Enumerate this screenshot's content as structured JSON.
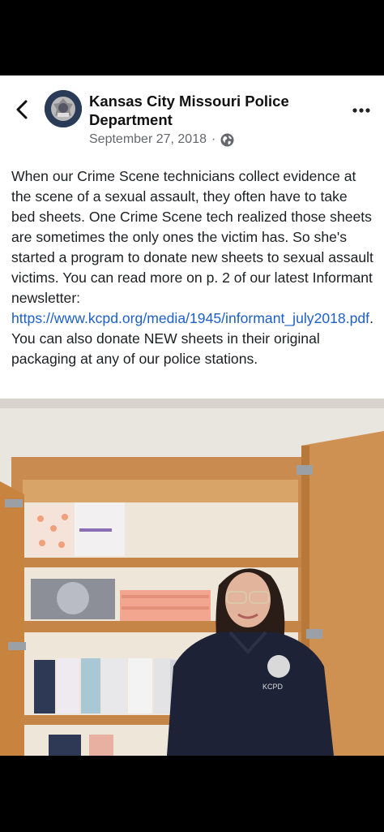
{
  "post": {
    "page_name": "Kansas City Missouri Police Department",
    "date": "September 27, 2018",
    "separator": "·",
    "text_before_link": "When our Crime Scene technicians collect evidence at the scene of a sexual assault, they often have to take bed sheets. One Crime Scene tech realized those sheets are sometimes the only ones the victim has. So she's started a program to donate new sheets to sexual assault victims. You can read more on p. 2 of our latest Informant newsletter: ",
    "link_text": "https://www.kcpd.org/media/1945/informant_july2018.pdf",
    "text_after_link": ".  You can also donate NEW sheets in their original packaging at any of our police stations.",
    "photo_shirt_text": "KCPD"
  },
  "icons": {
    "back": "chevron-left-icon",
    "more": "more-horizontal-icon",
    "privacy": "globe-icon"
  },
  "colors": {
    "link": "#1d5fc9",
    "meta": "#65676b",
    "background": "#000000"
  }
}
